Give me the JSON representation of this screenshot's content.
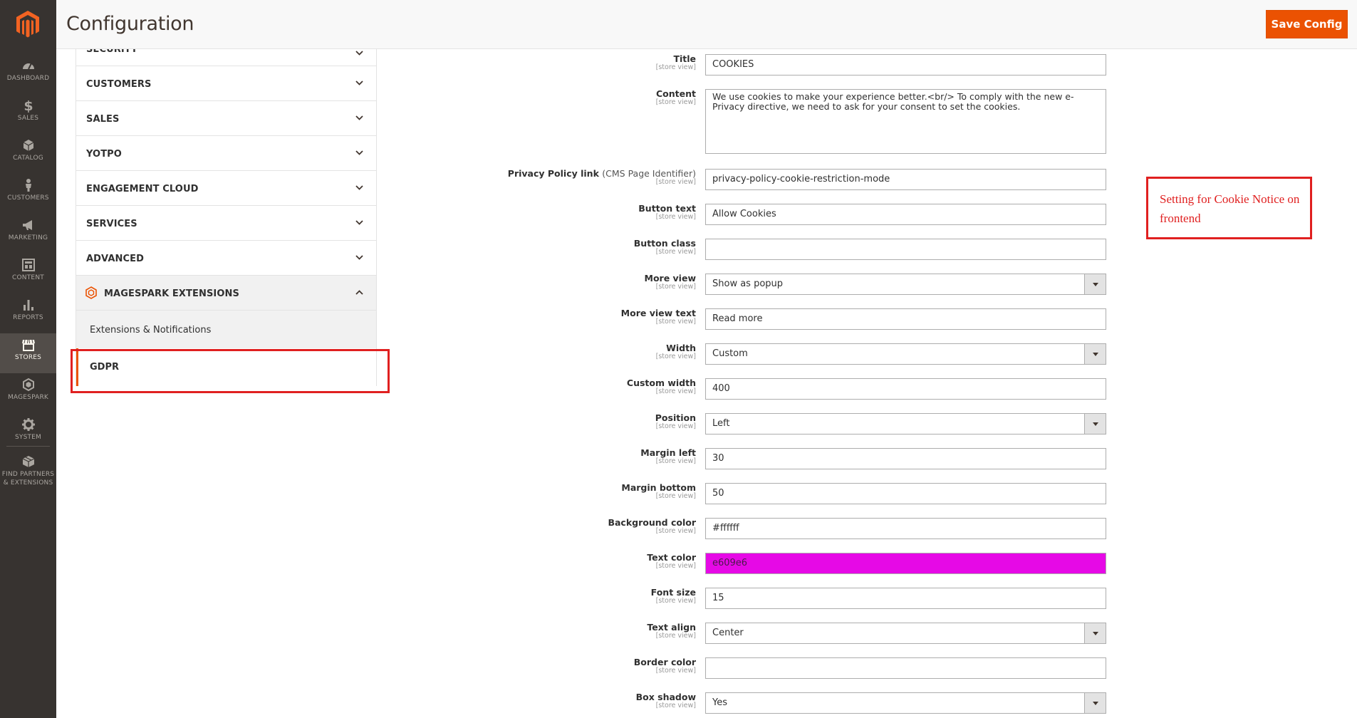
{
  "nav": {
    "items": [
      {
        "label": "DASHBOARD",
        "icon": "dashboard-icon"
      },
      {
        "label": "SALES",
        "icon": "dollar-icon"
      },
      {
        "label": "CATALOG",
        "icon": "cube-icon"
      },
      {
        "label": "CUSTOMERS",
        "icon": "person-icon"
      },
      {
        "label": "MARKETING",
        "icon": "megaphone-icon"
      },
      {
        "label": "CONTENT",
        "icon": "layout-icon"
      },
      {
        "label": "REPORTS",
        "icon": "bar-chart-icon"
      },
      {
        "label": "STORES",
        "icon": "storefront-icon"
      },
      {
        "label": "MAGESPARK",
        "icon": "magespark-icon"
      },
      {
        "label": "SYSTEM",
        "icon": "gear-icon"
      },
      {
        "label": "FIND PARTNERS & EXTENSIONS",
        "icon": "box-icon"
      }
    ],
    "active": "STORES"
  },
  "header": {
    "title": "Configuration",
    "save_label": "Save Config"
  },
  "tabs": {
    "items": [
      "SECURITY",
      "CUSTOMERS",
      "SALES",
      "YOTPO",
      "ENGAGEMENT CLOUD",
      "SERVICES",
      "ADVANCED",
      "MAGESPARK EXTENSIONS"
    ],
    "open_subitems": [
      "Extensions & Notifications",
      "GDPR"
    ],
    "active_subitem": "GDPR"
  },
  "scope_label": "[store view]",
  "form": {
    "title": {
      "label": "Title",
      "value": "COOKIES"
    },
    "content": {
      "label": "Content",
      "value": "We use cookies to make your experience better.<br/> To comply with the new e-Privacy directive, we need to ask for your consent to set the cookies."
    },
    "privacy_link": {
      "label": "Privacy Policy link",
      "label_hint": "(CMS Page Identifier)",
      "value": "privacy-policy-cookie-restriction-mode"
    },
    "button_text": {
      "label": "Button text",
      "value": "Allow Cookies"
    },
    "button_class": {
      "label": "Button class",
      "value": ""
    },
    "more_view": {
      "label": "More view",
      "value": "Show as popup"
    },
    "more_view_text": {
      "label": "More view text",
      "value": "Read more"
    },
    "width": {
      "label": "Width",
      "value": "Custom"
    },
    "custom_width": {
      "label": "Custom width",
      "value": "400"
    },
    "position": {
      "label": "Position",
      "value": "Left"
    },
    "margin_left": {
      "label": "Margin left",
      "value": "30"
    },
    "margin_bottom": {
      "label": "Margin bottom",
      "value": "50"
    },
    "background_color": {
      "label": "Background color",
      "value": "#ffffff"
    },
    "text_color": {
      "label": "Text color",
      "value": "e609e6",
      "swatch": "#e609e6"
    },
    "font_size": {
      "label": "Font size",
      "value": "15"
    },
    "text_align": {
      "label": "Text align",
      "value": "Center"
    },
    "border_color": {
      "label": "Border color",
      "value": ""
    },
    "box_shadow": {
      "label": "Box shadow",
      "value": "Yes"
    }
  },
  "annotation": {
    "text": "Setting for Cookie Notice on frontend"
  },
  "colors": {
    "accent": "#eb5202",
    "nav_bg": "#373330",
    "highlight": "#e02020"
  }
}
